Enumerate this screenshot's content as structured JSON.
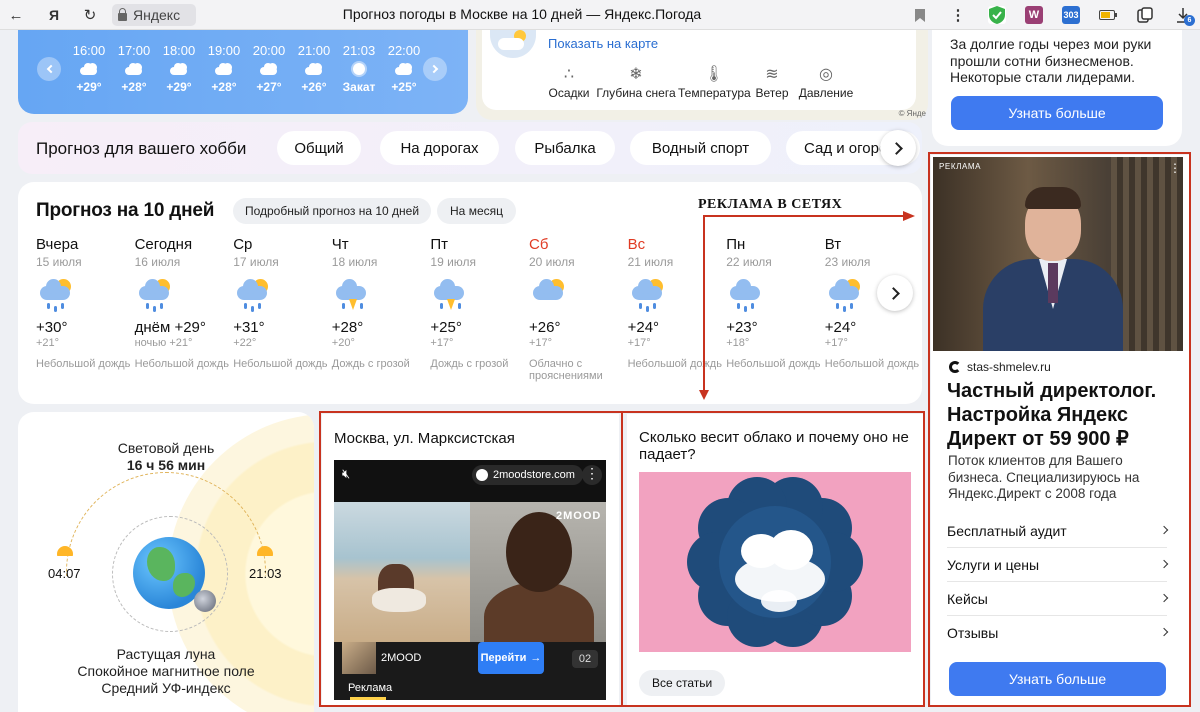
{
  "browser": {
    "url_host": "Яндекс",
    "page_title": "Прогноз погоды в Москве на 10 дней — Яндекс.Погода",
    "ext_calendar": "303",
    "ext_badge": "6"
  },
  "hourly": [
    {
      "time": "16:00",
      "temp": "+29°"
    },
    {
      "time": "17:00",
      "temp": "+28°"
    },
    {
      "time": "18:00",
      "temp": "+29°"
    },
    {
      "time": "19:00",
      "temp": "+28°"
    },
    {
      "time": "20:00",
      "temp": "+27°"
    },
    {
      "time": "21:00",
      "temp": "+26°"
    },
    {
      "time": "21:03",
      "temp": "Закат"
    },
    {
      "time": "22:00",
      "temp": "+25°"
    }
  ],
  "map": {
    "show_link": "Показать на карте",
    "params": [
      "Осадки",
      "Глубина снега",
      "Температура",
      "Ветер",
      "Давление"
    ],
    "copyright": "© Янде"
  },
  "hobby": {
    "title": "Прогноз для вашего хобби",
    "pills": [
      "Общий",
      "На дорогах",
      "Рыбалка",
      "Водный спорт",
      "Сад и огород"
    ]
  },
  "forecast": {
    "title": "Прогноз на 10 дней",
    "detail_chip": "Подробный прогноз на 10 дней",
    "month_chip": "На месяц",
    "days": [
      {
        "name": "Вчера",
        "date": "15 июля",
        "hi": "+30°",
        "lo": "+21°",
        "cond": "Небольшой дождь",
        "weekend": false,
        "icon": "sun-cloud-rain"
      },
      {
        "name": "Сегодня",
        "date": "16 июля",
        "hi": "днём +29°",
        "lo": "ночью +21°",
        "cond": "Небольшой дождь",
        "weekend": false,
        "icon": "sun-cloud-rain"
      },
      {
        "name": "Ср",
        "date": "17 июля",
        "hi": "+31°",
        "lo": "+22°",
        "cond": "Небольшой дождь",
        "weekend": false,
        "icon": "sun-cloud-rain"
      },
      {
        "name": "Чт",
        "date": "18 июля",
        "hi": "+28°",
        "lo": "+20°",
        "cond": "Дождь с грозой",
        "weekend": false,
        "icon": "cloud-storm"
      },
      {
        "name": "Пт",
        "date": "19 июля",
        "hi": "+25°",
        "lo": "+17°",
        "cond": "Дождь с грозой",
        "weekend": false,
        "icon": "cloud-storm"
      },
      {
        "name": "Сб",
        "date": "20 июля",
        "hi": "+26°",
        "lo": "+17°",
        "cond": "Облачно с прояснениями",
        "weekend": true,
        "icon": "sun-cloud"
      },
      {
        "name": "Вс",
        "date": "21 июля",
        "hi": "+24°",
        "lo": "+17°",
        "cond": "Небольшой дождь",
        "weekend": true,
        "icon": "sun-cloud-rain"
      },
      {
        "name": "Пн",
        "date": "22 июля",
        "hi": "+23°",
        "lo": "+18°",
        "cond": "Небольшой дождь",
        "weekend": false,
        "icon": "cloud-rain"
      },
      {
        "name": "Вт",
        "date": "23 июля",
        "hi": "+24°",
        "lo": "+17°",
        "cond": "Небольшой дождь",
        "weekend": false,
        "icon": "sun-cloud-rain"
      }
    ]
  },
  "annotation": "РЕКЛАМА В СЕТЯХ",
  "sun": {
    "daylight_label": "Световой день",
    "daylight_value": "16 ч 56 мин",
    "sunrise": "04:07",
    "sunset": "21:03",
    "lines": [
      "Растущая луна",
      "Спокойное магнитное поле",
      "Средний УФ-индекс"
    ]
  },
  "article1": {
    "title": "Москва, ул. Марксистская",
    "brand_domain": "2moodstore.com",
    "watermark": "2MOOD",
    "brand_name": "2MOOD",
    "go_label": "Перейти",
    "counter": "02",
    "ad_label": "Реклама"
  },
  "article2": {
    "title": "Сколько весит облако и почему оно не падает?",
    "all_label": "Все статьи"
  },
  "side_ad_top": {
    "text": "За долгие годы через мои руки прошли сотни бизнесменов. Некоторые стали лидерами.",
    "button": "Узнать больше"
  },
  "side_ad": {
    "label": "РЕКЛАМА",
    "domain": "stas-shmelev.ru",
    "headline": "Частный директолог. Настройка Яндекс Директ от 59 900 ₽",
    "description": "Поток клиентов для Вашего бизнеса. Специализируюсь на Яндекс.Директ с 2008 года",
    "links": [
      "Бесплатный аудит",
      "Услуги и цены",
      "Кейсы",
      "Отзывы"
    ],
    "button": "Узнать больше"
  },
  "colors": {
    "accent_blue": "#3f7af0",
    "weekend_red": "#e03b24",
    "annotation_red": "#c8331f"
  }
}
